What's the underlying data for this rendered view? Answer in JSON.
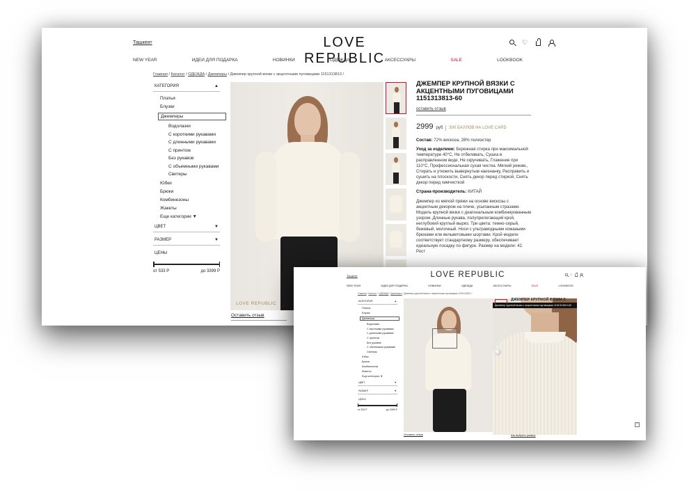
{
  "brand": {
    "logo": "LOVE REPUBLIC",
    "city": "Ташкент",
    "photo_brand": "LOVE REPUBLIC"
  },
  "icons": [
    "search-icon",
    "heart-icon",
    "bag-icon",
    "user-icon"
  ],
  "nav": [
    "NEW YEAR",
    "ИДЕИ ДЛЯ ПОДАРКА",
    "НОВИНКИ",
    "ОДЕЖДА",
    "АКСЕССУАРЫ",
    "SALE",
    "LOOKBOOK"
  ],
  "breadcrumbs": [
    "Главная",
    "Каталог",
    "ОДЕЖДА",
    "Джемперы",
    "Джемпер крупной вязки с акцентными пуговицами 1151313813"
  ],
  "breadcrumb_sep": "/",
  "sidebar": {
    "category": "КАТЕГОРИЯ",
    "category_toggle": "▲",
    "items_top": [
      "Платья",
      "Блузки"
    ],
    "active": "Джемперы",
    "subitems": [
      "Водолазки",
      "С короткими рукавами",
      "С длинными рукавами",
      "С принтом",
      "Без рукавов",
      "С объемными рукавами",
      "Свитеры"
    ],
    "items_bottom": [
      "Юбки",
      "Брюки",
      "Комбинезоны",
      "Жакеты"
    ],
    "more": "Еще категории ▼",
    "color": "ЦВЕТ",
    "size": "РАЗМЕР",
    "prices": "ЦЕНЫ",
    "arrow": "▼",
    "price_from": "от 533 Р",
    "price_to": "до 3399 Р"
  },
  "product": {
    "title": "ДЖЕМПЕР КРУПНОЙ ВЯЗКИ С АКЦЕНТНЫМИ ПУГОВИЦАМИ 1151313813-60",
    "leave_review": "оставить отзыв",
    "price": "2999",
    "currency": "руб",
    "bonus": "300 БАЛЛОВ НА LOVE CARD",
    "composition_label": "Состав:",
    "composition": "72% вискоза, 28% полиэстер",
    "care_label": "Уход за изделием:",
    "care": "Бережная стирка при максимальной температуре 40°С, Не отбеливать, Сушка в расправленном виде, Не скручивать, Глажение при 110°С, Профессиональная сухая чистка. Мягкий режим., Стирать и утюжить вывернутым наизнанку, Расправить и сушить на плоскости, Снять декор перед стиркой, Снять декор перед химчисткой",
    "country_label": "Страна-производитель:",
    "country": "КИТАЙ",
    "description": "Джемпер из мягкой пряжи на основе вискозы с акцентным декором на плече, усыпанным стразами. Модель крупной вязки с диагональным комбинированным узором. Длинные рукава, полуприлегающий крой, неглубокий круглый вырез. Три цвета: темно-серый, бежевый, молочный. Носи с ультрамодными кожаными брюками или вельветовыми шортами. Крой модели соответствует стандартному размеру, обеспечивает идеальную посадку по фигуре. Размер на модели: 42. Рост",
    "review_under_photo": "Оставить отзыв"
  },
  "zoom": {
    "tooltip": "Джемпер крупной вязки с акцентными пуговицами 1151313813-60",
    "title": "ДЖЕМПЕР КРУПНОЙ ВЯЗКИ С",
    "caption": "Как выбрать размер"
  },
  "scroll_top": "^",
  "colors": {
    "sale": "#c8102e",
    "accent": "#a58a5a",
    "selected_thumb": "#c8102e"
  }
}
